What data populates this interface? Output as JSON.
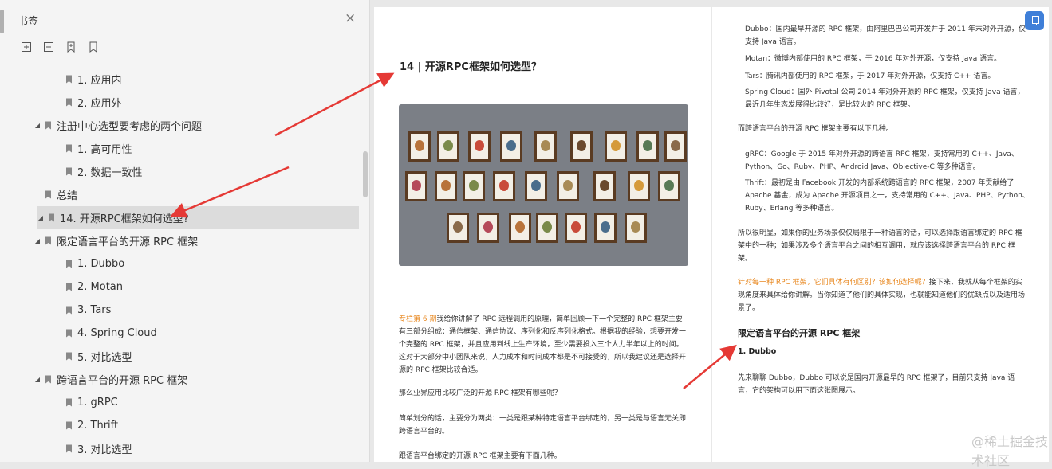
{
  "sidebar": {
    "title": "书签",
    "close_glyph": "×",
    "toolbar": [
      {
        "name": "expand-all-icon"
      },
      {
        "name": "collapse-all-icon"
      },
      {
        "name": "add-bookmark-icon"
      },
      {
        "name": "bookmark-icon"
      }
    ],
    "items": [
      {
        "label": "1. 应用内",
        "level": 2,
        "expandable": false
      },
      {
        "label": "2. 应用外",
        "level": 2,
        "expandable": false
      },
      {
        "label": "注册中心选型要考虑的两个问题",
        "level": 1,
        "expandable": true
      },
      {
        "label": "1. 高可用性",
        "level": 2,
        "expandable": false
      },
      {
        "label": "2. 数据一致性",
        "level": 2,
        "expandable": false
      },
      {
        "label": "总结",
        "level": 1,
        "expandable": false
      },
      {
        "label": "14. 开源RPC框架如何选型?",
        "level": 0,
        "expandable": true,
        "selected": true
      },
      {
        "label": "限定语言平台的开源 RPC 框架",
        "level": 1,
        "expandable": true
      },
      {
        "label": "1. Dubbo",
        "level": 2,
        "expandable": false
      },
      {
        "label": "2. Motan",
        "level": 2,
        "expandable": false
      },
      {
        "label": "3. Tars",
        "level": 2,
        "expandable": false
      },
      {
        "label": "4. Spring Cloud",
        "level": 2,
        "expandable": false
      },
      {
        "label": "5. 对比选型",
        "level": 2,
        "expandable": false
      },
      {
        "label": "跨语言平台的开源 RPC 框架",
        "level": 1,
        "expandable": true
      },
      {
        "label": "1. gRPC",
        "level": 2,
        "expandable": false
      },
      {
        "label": "2. Thrift",
        "level": 2,
        "expandable": false
      },
      {
        "label": "3. 对比选型",
        "level": 2,
        "expandable": false
      }
    ]
  },
  "page_left": {
    "title": "14 | 开源RPC框架如何选型？",
    "p1_link": "专栏第 6 期",
    "p1_lines": [
      "我给你讲解了 RPC 远程调用的原理，简单回顾一下一个完整的 RPC 框架主要",
      "有三部分组成：通信框架、通信协议、序列化和反序列化格式。根据我的经验，想要开发一",
      "个完整的 RPC 框架，并且应用到线上生产环境，至少需要投入三个人力半年以上的时间。",
      "这对于大部分中小团队来说，人力成本和时间成本都是不可接受的，所以我建议还是选择开",
      "源的 RPC 框架比较合适。"
    ],
    "p2": "那么业界应用比较广泛的开源 RPC 框架有哪些呢？",
    "p3_lines": [
      "简单划分的话，主要分为两类：一类是跟某种特定语言平台绑定的，另一类是与语言无关即",
      "跨语言平台的。"
    ],
    "p4": "跟语言平台绑定的开源 RPC 框架主要有下面几种。"
  },
  "page_right": {
    "dubbo_lines": [
      "Dubbo：国内最早开源的 RPC 框架，由阿里巴巴公司开发并于 2011 年末对外开源，仅",
      "支持 Java 语言。"
    ],
    "motan": "Motan：微博内部使用的 RPC 框架，于 2016 年对外开源，仅支持 Java 语言。",
    "tars": "Tars：腾讯内部使用的 RPC 框架，于 2017 年对外开源，仅支持 C++ 语言。",
    "spring_lines": [
      "Spring Cloud：国外 Pivotal 公司 2014 年对外开源的 RPC 框架，仅支持 Java 语言，",
      "最近几年生态发展得比较好，是比较火的 RPC 框架。"
    ],
    "cross_intro": "而跨语言平台的开源 RPC 框架主要有以下几种。",
    "grpc_lines": [
      "gRPC：Google 于 2015 年对外开源的跨语言 RPC 框架，支持常用的 C++、Java、",
      "Python、Go、Ruby、PHP、Android Java、Objective-C 等多种语言。"
    ],
    "thrift_lines": [
      "Thrift：最初是由 Facebook 开发的内部系统跨语言的 RPC 框架，2007 年贡献给了",
      "Apache 基金，成为 Apache 开源项目之一，支持常用的 C++、Java、PHP、Python、",
      "Ruby、Erlang 等多种语言。"
    ],
    "summary_lines": [
      "所以很明显，如果你的业务场景仅仅局限于一种语言的话，可以选择跟语言绑定的 RPC 框",
      "架中的一种；如果涉及多个语言平台之间的相互调用，就应该选择跨语言平台的 RPC 框",
      "架。"
    ],
    "q_orange": "针对每一种 RPC 框架，它们具体有何区别？该如何选择呢？",
    "q_rest_lines": [
      "接下来，我就从每个框架的实",
      "现角度来具体给你讲解。当你知道了他们的具体实现，也就能知道他们的优缺点以及适用场",
      "景了。"
    ],
    "section_title": "限定语言平台的开源 RPC 框架",
    "sub_title": "1. Dubbo",
    "dubbo_intro_lines": [
      "先来聊聊 Dubbo，Dubbo 可以说是国内开源最早的 RPC 框架了，目前只支持 Java 语",
      "言，它的架构可以用下面这张图展示。"
    ]
  },
  "watermark": "@稀土掘金技术社区",
  "colors": {
    "accent_orange": "#e8871e",
    "arrow_red": "#e53935",
    "corner_button": "#3f7fd8"
  }
}
